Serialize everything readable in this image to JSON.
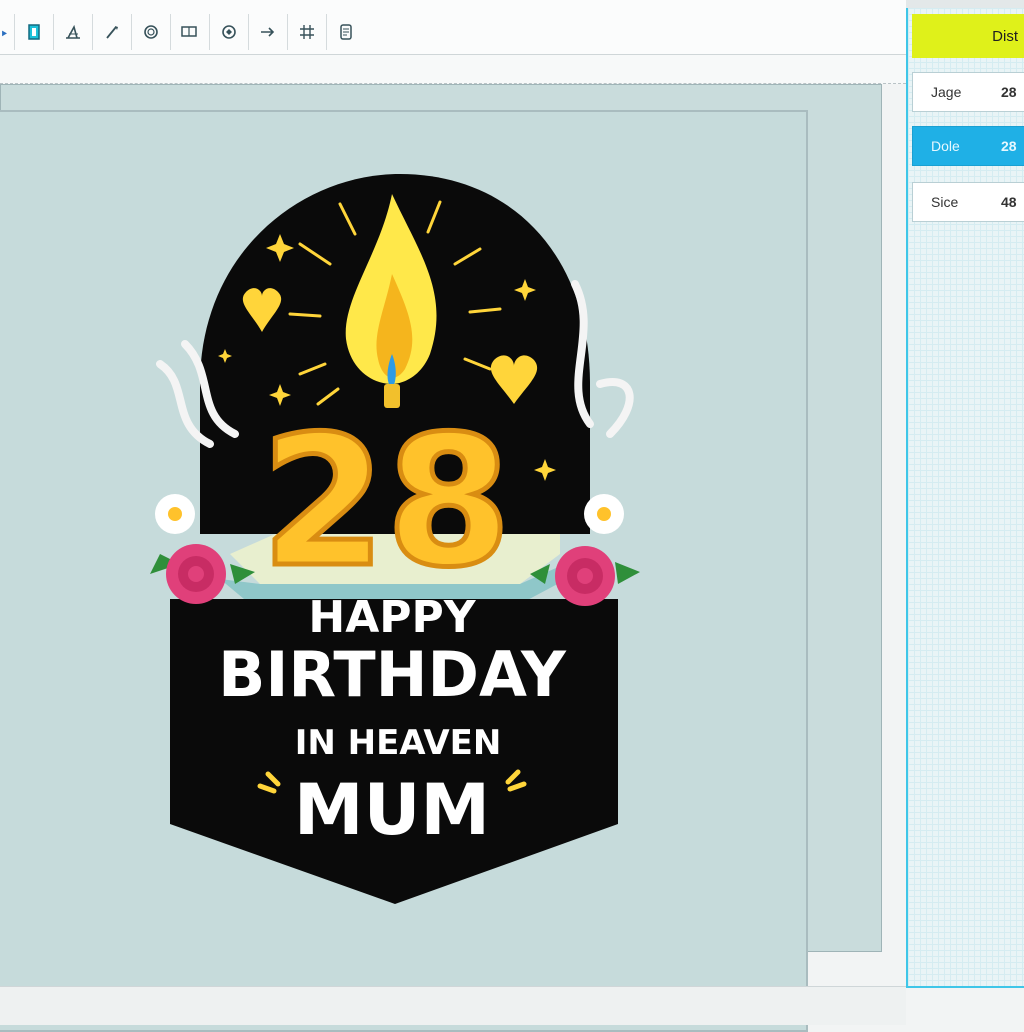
{
  "toolbar": {
    "tools": [
      "pointer-tool-icon",
      "frame-tool-icon",
      "chart-tool-icon",
      "pen-tool-icon",
      "target-tool-icon",
      "rectangle-tool-icon",
      "stamp-tool-icon",
      "arrow-tool-icon",
      "grid-tool-icon",
      "layers-tool-icon"
    ]
  },
  "panel": {
    "header": "Dist",
    "rows": [
      {
        "label": "Jage",
        "value": "28"
      },
      {
        "label": "Dole",
        "value": "28"
      },
      {
        "label": "Sice",
        "value": "48"
      }
    ],
    "selected_index": 1
  },
  "design": {
    "number": "28",
    "line1": "HAPPY",
    "line2": "BIRTHDAY",
    "line3": "IN HEAVEN",
    "line4": "MUM"
  },
  "colors": {
    "accent": "#1fb0e6",
    "header": "#dff11a",
    "canvas": "#c6dbdb",
    "badge": "#0a0a0a",
    "number": "#ffc22b"
  }
}
